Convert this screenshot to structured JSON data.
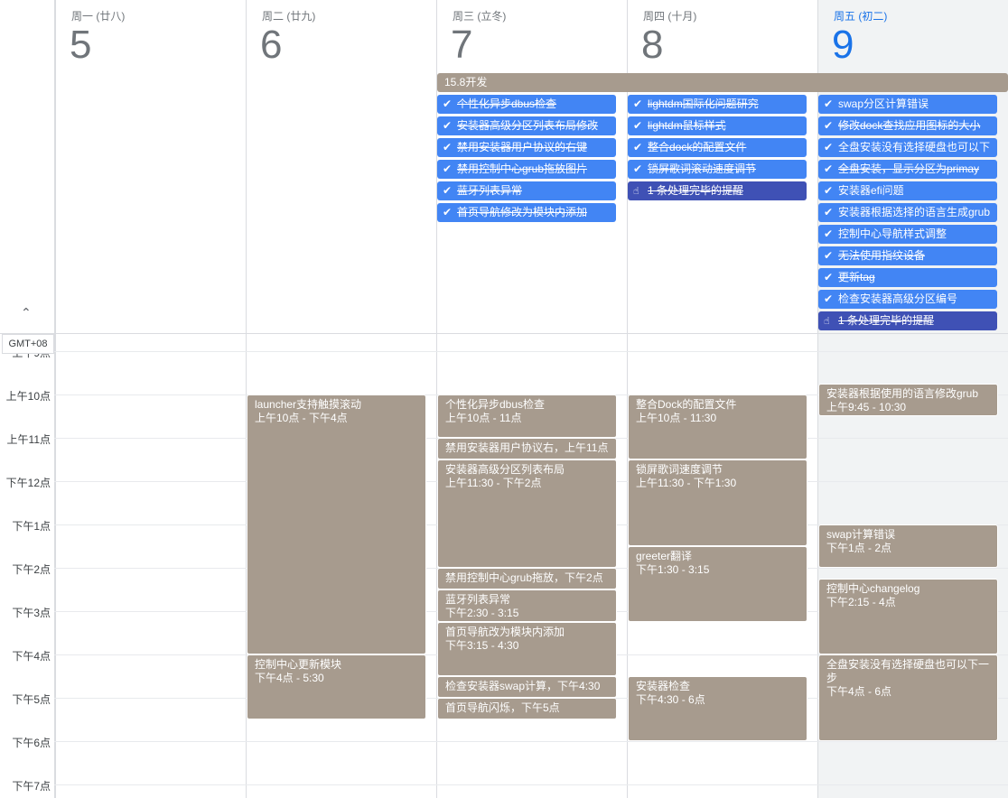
{
  "timezone": "GMT+08",
  "collapse_symbol": "⌃",
  "days": [
    {
      "name": "周一 (廿八)",
      "num": "5"
    },
    {
      "name": "周二 (廿九)",
      "num": "6"
    },
    {
      "name": "周三 (立冬)",
      "num": "7"
    },
    {
      "name": "周四 (十月)",
      "num": "8"
    },
    {
      "name": "周五 (初二)",
      "num": "9"
    }
  ],
  "banner": "15.8开发",
  "wed_tasks": [
    {
      "text": "个性化异步dbus检查",
      "done": true
    },
    {
      "text": "安装器高级分区列表布局修改",
      "done": true
    },
    {
      "text": "禁用安装器用户协议的右键",
      "done": true
    },
    {
      "text": "禁用控制中心grub拖放图片",
      "done": true
    },
    {
      "text": "蓝牙列表异常",
      "done": true
    },
    {
      "text": "首页导航修改为模块内添加",
      "done": true
    }
  ],
  "thu_tasks": [
    {
      "text": "lightdm国际化问题研究",
      "done": true
    },
    {
      "text": "lightdm鼠标样式",
      "done": true
    },
    {
      "text": "整合dock的配置文件",
      "done": true
    },
    {
      "text": "锁屏歌词滚动速度调节",
      "done": true
    }
  ],
  "thu_reminder": "1 条处理完毕的提醒",
  "fri_tasks": [
    {
      "text": "swap分区计算错误",
      "done": false
    },
    {
      "text": "修改dock查找应用图标的大小",
      "done": true
    },
    {
      "text": "全盘安装没有选择硬盘也可以下",
      "done": false
    },
    {
      "text": "全盘安装，显示分区为primay",
      "done": true
    },
    {
      "text": "安装器efi问题",
      "done": false
    },
    {
      "text": "安装器根据选择的语言生成grub",
      "done": false
    },
    {
      "text": "控制中心导航样式调整",
      "done": false
    },
    {
      "text": "无法使用指纹设备",
      "done": true
    },
    {
      "text": "更新tag",
      "done": true
    },
    {
      "text": "检查安装器高级分区编号",
      "done": false
    }
  ],
  "fri_reminder": "1 条处理完毕的提醒",
  "hours": [
    "上午9点",
    "上午10点",
    "上午11点",
    "下午12点",
    "下午1点",
    "下午2点",
    "下午3点",
    "下午4点",
    "下午5点",
    "下午6点",
    "下午7点"
  ],
  "events": [
    {
      "day": 1,
      "name": "launcher支持触摸滚动",
      "time": "上午10点 - 下午4点",
      "start": 10,
      "end": 16
    },
    {
      "day": 1,
      "name": "控制中心更新模块",
      "time": "下午4点 - 5:30",
      "start": 16,
      "end": 17.5
    },
    {
      "day": 2,
      "name": "个性化异步dbus检查",
      "time": "上午10点 - 11点",
      "start": 10,
      "end": 11
    },
    {
      "day": 2,
      "name": "禁用安装器用户协议右，上午11点",
      "time": "",
      "start": 11,
      "end": 11.5
    },
    {
      "day": 2,
      "name": "安装器高级分区列表布局",
      "time": "上午11:30 - 下午2点",
      "start": 11.5,
      "end": 14
    },
    {
      "day": 2,
      "name": "禁用控制中心grub拖放，下午2点",
      "time": "",
      "start": 14,
      "end": 14.5
    },
    {
      "day": 2,
      "name": "蓝牙列表异常",
      "time": "下午2:30 - 3:15",
      "start": 14.5,
      "end": 15.25
    },
    {
      "day": 2,
      "name": "首页导航改为模块内添加",
      "time": "下午3:15 - 4:30",
      "start": 15.25,
      "end": 16.5
    },
    {
      "day": 2,
      "name": "检查安装器swap计算，下午4:30",
      "time": "",
      "start": 16.5,
      "end": 17
    },
    {
      "day": 2,
      "name": "首页导航闪烁，下午5点",
      "time": "",
      "start": 17,
      "end": 17.5
    },
    {
      "day": 3,
      "name": "整合Dock的配置文件",
      "time": "上午10点 - 11:30",
      "start": 10,
      "end": 11.5
    },
    {
      "day": 3,
      "name": "锁屏歌词速度调节",
      "time": "上午11:30 - 下午1:30",
      "start": 11.5,
      "end": 13.5
    },
    {
      "day": 3,
      "name": "greeter翻译",
      "time": "下午1:30 - 3:15",
      "start": 13.5,
      "end": 15.25
    },
    {
      "day": 3,
      "name": "安装器检查",
      "time": "下午4:30 - 6点",
      "start": 16.5,
      "end": 18
    },
    {
      "day": 4,
      "name": "安装器根据使用的语言修改grub",
      "time": "上午9:45 - 10:30",
      "start": 9.75,
      "end": 10.5
    },
    {
      "day": 4,
      "name": "swap计算错误",
      "time": "下午1点 - 2点",
      "start": 13,
      "end": 14
    },
    {
      "day": 4,
      "name": "控制中心changelog",
      "time": "下午2:15 - 4点",
      "start": 14.25,
      "end": 16
    },
    {
      "day": 4,
      "name": "全盘安装没有选择硬盘也可以下一步",
      "time": "下午4点 - 6点",
      "start": 16,
      "end": 18
    }
  ]
}
